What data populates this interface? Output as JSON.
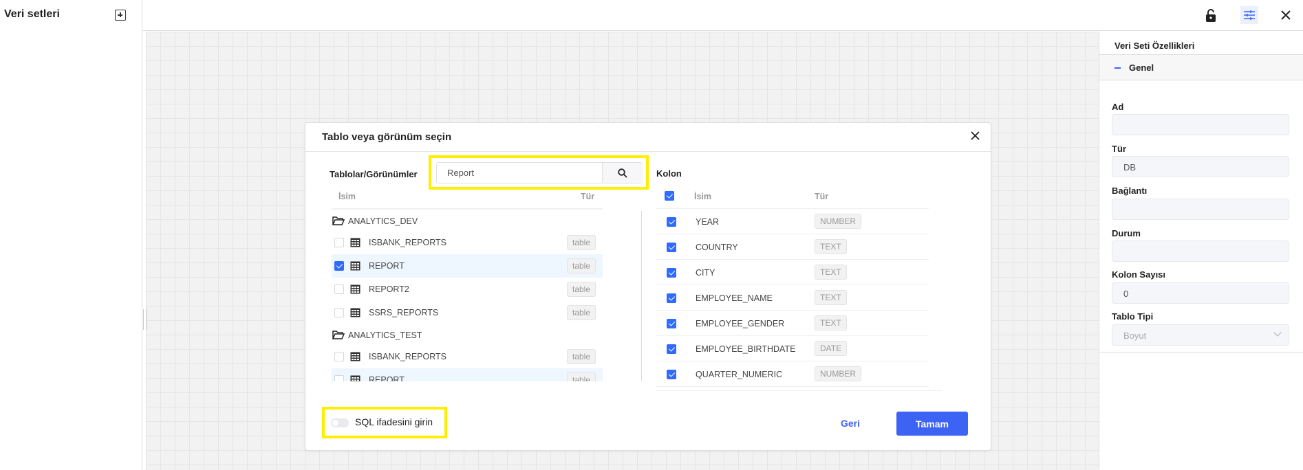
{
  "sidebar": {
    "title": "Veri setleri",
    "add_icon": "plus-square-icon"
  },
  "toolbar": {
    "icons": [
      "lock-open-icon",
      "sliders-icon",
      "close-icon"
    ]
  },
  "panel": {
    "title": "Veri Seti Özellikleri",
    "section": "Genel",
    "fields": [
      {
        "label": "Ad",
        "value": ""
      },
      {
        "label": "Tür",
        "value": "DB"
      },
      {
        "label": "Bağlantı",
        "value": ""
      },
      {
        "label": "Durum",
        "value": ""
      },
      {
        "label": "Kolon Sayısı",
        "value": "0"
      },
      {
        "label": "Tablo Tipi",
        "value": "Boyut"
      }
    ]
  },
  "dialog": {
    "title": "Tablo veya görünüm seçin",
    "tables_label": "Tablolar/Görünümler",
    "search_value": "Report",
    "left_headers": {
      "name": "İsim",
      "type": "Tür"
    },
    "groups": [
      {
        "name": "ANALYTICS_DEV",
        "items": [
          {
            "name": "ISBANK_REPORTS",
            "type": "table",
            "checked": false
          },
          {
            "name": "REPORT",
            "type": "table",
            "checked": true
          },
          {
            "name": "REPORT2",
            "type": "table",
            "checked": false
          },
          {
            "name": "SSRS_REPORTS",
            "type": "table",
            "checked": false
          }
        ]
      },
      {
        "name": "ANALYTICS_TEST",
        "items": [
          {
            "name": "ISBANK_REPORTS",
            "type": "table",
            "checked": false
          },
          {
            "name": "REPORT",
            "type": "table",
            "checked": false
          }
        ]
      }
    ],
    "columns_label": "Kolon",
    "col_headers": {
      "name": "İsim",
      "type": "Tür"
    },
    "columns": [
      {
        "name": "YEAR",
        "type": "NUMBER"
      },
      {
        "name": "COUNTRY",
        "type": "TEXT"
      },
      {
        "name": "CITY",
        "type": "TEXT"
      },
      {
        "name": "EMPLOYEE_NAME",
        "type": "TEXT"
      },
      {
        "name": "EMPLOYEE_GENDER",
        "type": "TEXT"
      },
      {
        "name": "EMPLOYEE_BIRTHDATE",
        "type": "DATE"
      },
      {
        "name": "QUARTER_NUMERIC",
        "type": "NUMBER"
      }
    ],
    "sql_toggle": "SQL ifadesini girin",
    "back": "Geri",
    "ok": "Tamam"
  },
  "colors": {
    "accent": "#3d63f5",
    "highlight": "#ffee00",
    "selected_row": "#eef6ff"
  }
}
